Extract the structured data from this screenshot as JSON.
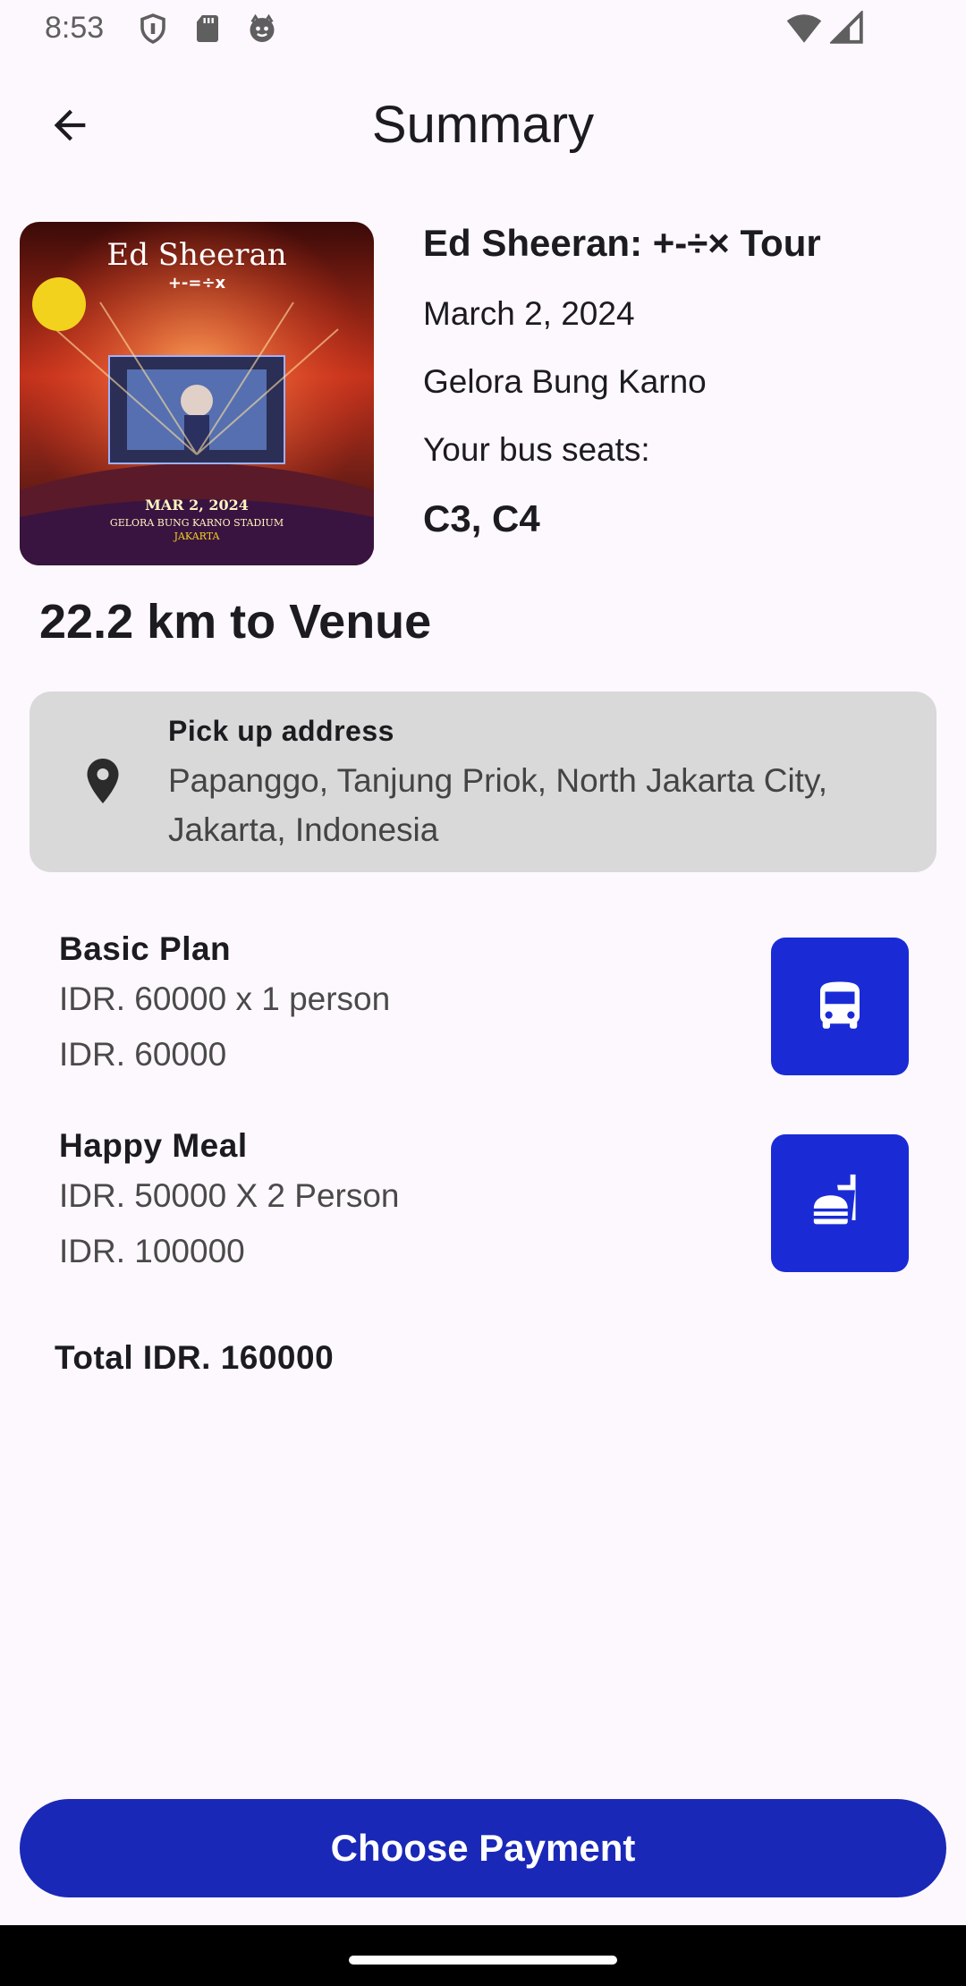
{
  "status_bar": {
    "time": "8:53",
    "icons": [
      "shield-icon",
      "sd-card-icon",
      "face-icon",
      "wifi-icon",
      "signal-icon"
    ]
  },
  "app_bar": {
    "title": "Summary",
    "back_icon": "arrow-back-icon"
  },
  "event": {
    "title": "Ed Sheeran: +-÷× Tour",
    "date": "March 2, 2024",
    "venue": "Gelora Bung Karno",
    "seats_label": "Your bus seats:",
    "seats": "C3, C4",
    "poster": {
      "artist": "Ed Sheeran",
      "tour": "+-=÷x",
      "date": "MAR 2, 2024",
      "stadium": "GELORA BUNG KARNO STADIUM",
      "city": "JAKARTA"
    }
  },
  "distance": "22.2 km to Venue",
  "pickup": {
    "label": "Pick up address",
    "address": "Papanggo, Tanjung Priok, North Jakarta City, Jakarta, Indonesia",
    "icon": "location-pin-icon"
  },
  "items": [
    {
      "name": "Basic Plan",
      "detail": "IDR. 60000 x 1 person",
      "price": "IDR. 60000",
      "icon": "bus-icon"
    },
    {
      "name": "Happy Meal",
      "detail": "IDR. 50000 X 2 Person",
      "price": "IDR. 100000",
      "icon": "fastfood-icon"
    }
  ],
  "total": "Total IDR. 160000",
  "actions": {
    "choose_payment": "Choose Payment"
  },
  "colors": {
    "primary": "#1a28b8",
    "icon_tile": "#1a2bd6",
    "card_bg": "#d9d9d9",
    "background": "#fdf8fd"
  }
}
